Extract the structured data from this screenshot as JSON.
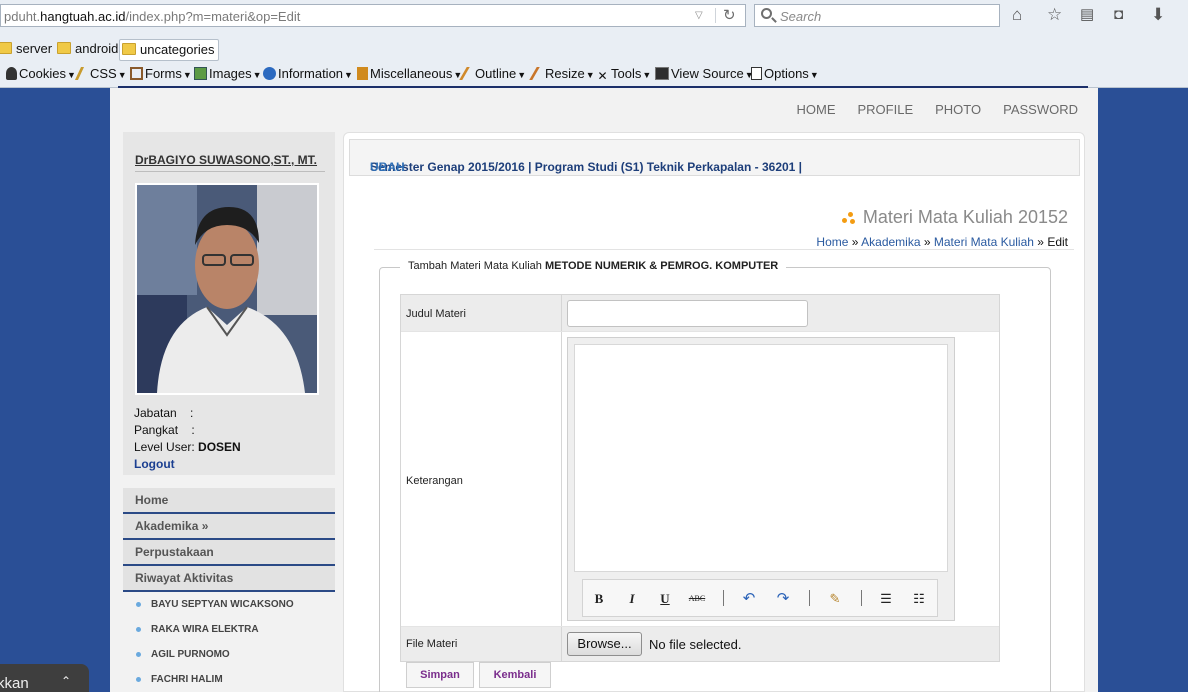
{
  "browser": {
    "url_prefix": "pduht.",
    "url_host": "hangtuah.ac.id",
    "url_path": "/index.php?m=materi&op=Edit",
    "search_placeholder": "Search",
    "bookmarks": [
      "server",
      "android",
      "uncategories"
    ],
    "devbar": [
      "Cookies",
      "CSS",
      "Forms",
      "Images",
      "Information",
      "Miscellaneous",
      "Outline",
      "Resize",
      "Tools",
      "View Source",
      "Options"
    ]
  },
  "topnav": [
    "HOME",
    "PROFILE",
    "PHOTO",
    "PASSWORD"
  ],
  "profile": {
    "name": "DrBAGIYO SUWASONO,ST., MT.",
    "jabatan_label": "Jabatan",
    "pangkat_label": "Pangkat",
    "level_label": "Level User:",
    "level_value": "DOSEN",
    "colon": ":",
    "logout": "Logout"
  },
  "menu": {
    "items": [
      "Home",
      "Akademika »",
      "Perpustakaan",
      "Riwayat Aktivitas"
    ],
    "activity": [
      "BAYU SEPTYAN WICAKSONO",
      "RAKA WIRA ELEKTRA",
      "AGIL PURNOMO",
      "FACHRI HALIM"
    ]
  },
  "semester": {
    "text": "Semester Genap 2015/2016 | Program Studi (S1) Teknik Perkapalan - 36201 |",
    "link": "UBAH"
  },
  "page_title": "Materi Mata Kuliah 20152",
  "breadcrumb": {
    "home": "Home",
    "sep": "»",
    "akademika": "Akademika",
    "materi": "Materi Mata Kuliah",
    "current": "Edit"
  },
  "form": {
    "legend_prefix": "Tambah Materi Mata Kuliah",
    "legend_course": "METODE NUMERIK & PEMROG. KOMPUTER",
    "judul_label": "Judul Materi",
    "judul_value": "",
    "keterangan_label": "Keterangan",
    "file_label": "File Materi",
    "browse_label": "Browse...",
    "no_file": "No file selected.",
    "save_label": "Simpan",
    "back_label": "Kembali",
    "editor_tools": [
      "B",
      "I",
      "U",
      "ABC"
    ]
  },
  "toast": {
    "text": "kkan",
    "chevron": "⌃"
  }
}
